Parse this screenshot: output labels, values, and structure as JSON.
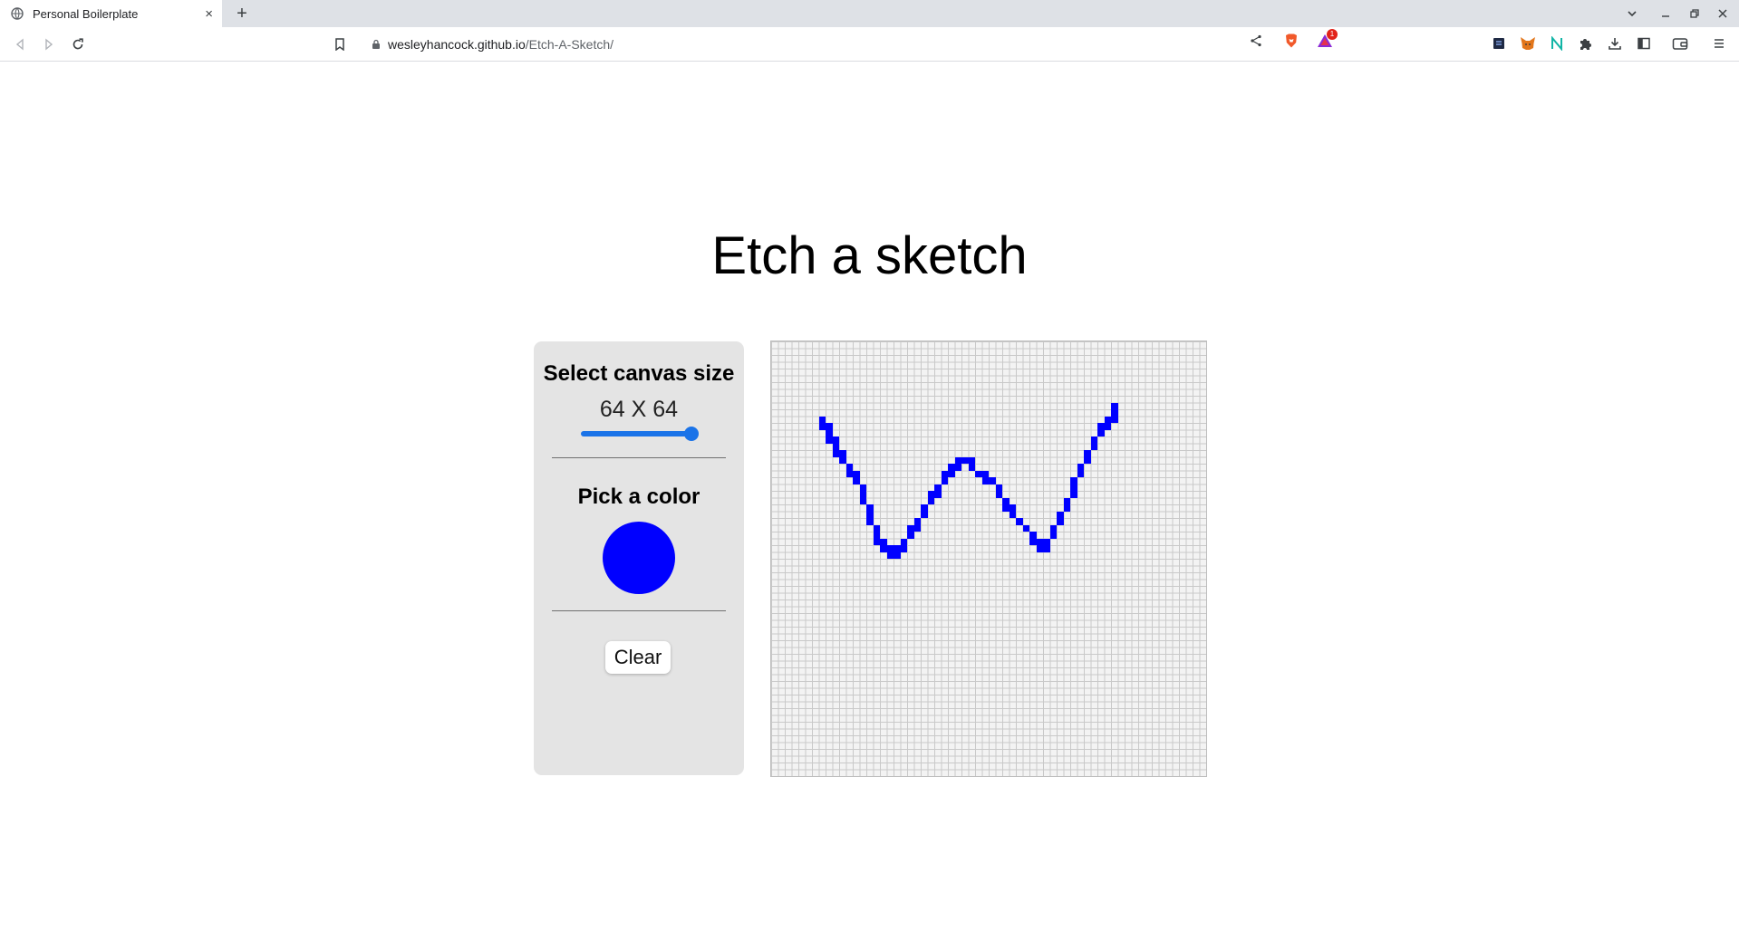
{
  "browser": {
    "tab_title": "Personal Boilerplate",
    "tab_close": "×",
    "new_tab": "+",
    "url_host": "wesleyhancock.github.io",
    "url_path": "/Etch-A-Sketch/",
    "notification_count": "1"
  },
  "page": {
    "title": "Etch a sketch"
  },
  "controls": {
    "canvas_size_heading": "Select canvas size",
    "canvas_size_value": "64 X 64",
    "canvas_size_slider_fraction": 1.0,
    "color_heading": "Pick a color",
    "selected_color": "#0000ff",
    "clear_label": "Clear"
  },
  "canvas": {
    "grid_size": 64,
    "ink_color": "#0000ff",
    "grid_line_color": "#c9c9c9",
    "background_color": "#f3f3f3",
    "filled_cells": [
      [
        7,
        11
      ],
      [
        7,
        12
      ],
      [
        8,
        12
      ],
      [
        8,
        13
      ],
      [
        8,
        14
      ],
      [
        9,
        14
      ],
      [
        9,
        15
      ],
      [
        9,
        16
      ],
      [
        10,
        16
      ],
      [
        10,
        17
      ],
      [
        11,
        18
      ],
      [
        11,
        19
      ],
      [
        12,
        19
      ],
      [
        12,
        20
      ],
      [
        13,
        21
      ],
      [
        13,
        22
      ],
      [
        13,
        23
      ],
      [
        14,
        24
      ],
      [
        14,
        25
      ],
      [
        14,
        26
      ],
      [
        15,
        27
      ],
      [
        15,
        28
      ],
      [
        15,
        29
      ],
      [
        16,
        29
      ],
      [
        16,
        30
      ],
      [
        17,
        30
      ],
      [
        17,
        31
      ],
      [
        18,
        30
      ],
      [
        18,
        31
      ],
      [
        19,
        30
      ],
      [
        19,
        29
      ],
      [
        20,
        28
      ],
      [
        20,
        27
      ],
      [
        21,
        27
      ],
      [
        21,
        26
      ],
      [
        22,
        25
      ],
      [
        22,
        24
      ],
      [
        23,
        23
      ],
      [
        23,
        22
      ],
      [
        24,
        22
      ],
      [
        24,
        21
      ],
      [
        25,
        20
      ],
      [
        25,
        19
      ],
      [
        26,
        19
      ],
      [
        26,
        18
      ],
      [
        27,
        18
      ],
      [
        27,
        17
      ],
      [
        28,
        17
      ],
      [
        29,
        17
      ],
      [
        29,
        18
      ],
      [
        30,
        19
      ],
      [
        31,
        19
      ],
      [
        31,
        20
      ],
      [
        32,
        20
      ],
      [
        33,
        21
      ],
      [
        33,
        22
      ],
      [
        34,
        23
      ],
      [
        34,
        24
      ],
      [
        35,
        24
      ],
      [
        35,
        25
      ],
      [
        36,
        26
      ],
      [
        37,
        27
      ],
      [
        38,
        28
      ],
      [
        38,
        29
      ],
      [
        39,
        29
      ],
      [
        39,
        30
      ],
      [
        40,
        30
      ],
      [
        40,
        29
      ],
      [
        41,
        28
      ],
      [
        41,
        27
      ],
      [
        42,
        26
      ],
      [
        42,
        25
      ],
      [
        43,
        24
      ],
      [
        43,
        23
      ],
      [
        44,
        22
      ],
      [
        44,
        21
      ],
      [
        44,
        20
      ],
      [
        45,
        19
      ],
      [
        45,
        18
      ],
      [
        46,
        17
      ],
      [
        46,
        16
      ],
      [
        47,
        15
      ],
      [
        47,
        14
      ],
      [
        48,
        13
      ],
      [
        48,
        12
      ],
      [
        49,
        12
      ],
      [
        49,
        11
      ],
      [
        50,
        11
      ],
      [
        50,
        10
      ],
      [
        50,
        9
      ]
    ]
  }
}
